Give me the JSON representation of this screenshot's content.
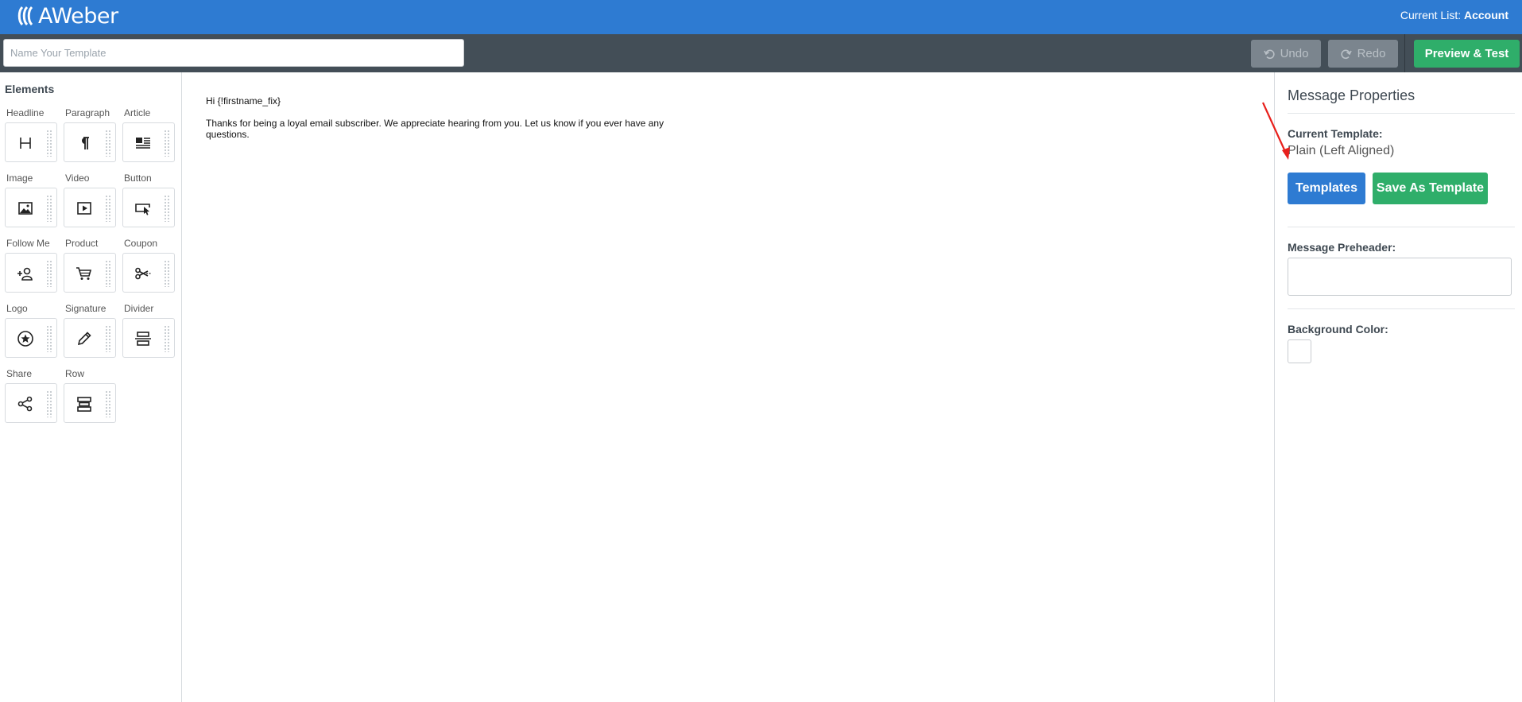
{
  "header": {
    "logo_text": "AWeber",
    "current_list_label": "Current List:",
    "current_list_value": "Account"
  },
  "toolbar": {
    "template_name_placeholder": "Name Your Template",
    "template_name_value": "",
    "undo_label": "Undo",
    "redo_label": "Redo",
    "preview_label": "Preview & Test"
  },
  "sidebar": {
    "title": "Elements",
    "items": [
      {
        "label": "Headline",
        "icon": "headline-icon"
      },
      {
        "label": "Paragraph",
        "icon": "paragraph-icon"
      },
      {
        "label": "Article",
        "icon": "article-icon"
      },
      {
        "label": "Image",
        "icon": "image-icon"
      },
      {
        "label": "Video",
        "icon": "video-icon"
      },
      {
        "label": "Button",
        "icon": "button-icon"
      },
      {
        "label": "Follow Me",
        "icon": "follow-me-icon"
      },
      {
        "label": "Product",
        "icon": "cart-icon"
      },
      {
        "label": "Coupon",
        "icon": "scissors-icon"
      },
      {
        "label": "Logo",
        "icon": "star-circle-icon"
      },
      {
        "label": "Signature",
        "icon": "pen-icon"
      },
      {
        "label": "Divider",
        "icon": "divider-icon"
      },
      {
        "label": "Share",
        "icon": "share-icon"
      },
      {
        "label": "Row",
        "icon": "row-icon"
      }
    ]
  },
  "email": {
    "greeting": "Hi {!firstname_fix}",
    "body": "Thanks for being a loyal email subscriber. We appreciate hearing from you. Let us know if you ever have any questions."
  },
  "properties": {
    "title": "Message Properties",
    "current_template_label": "Current Template:",
    "current_template_value": "Plain (Left Aligned)",
    "templates_button": "Templates",
    "save_as_template_button": "Save As Template",
    "preheader_label": "Message Preheader:",
    "preheader_value": "",
    "background_color_label": "Background Color:",
    "background_color_value": "#ffffff"
  },
  "colors": {
    "brand_blue": "#2e7bd2",
    "toolbar_dark": "#434e57",
    "success_green": "#2fae6a",
    "annotation_arrow": "#e8201c"
  }
}
